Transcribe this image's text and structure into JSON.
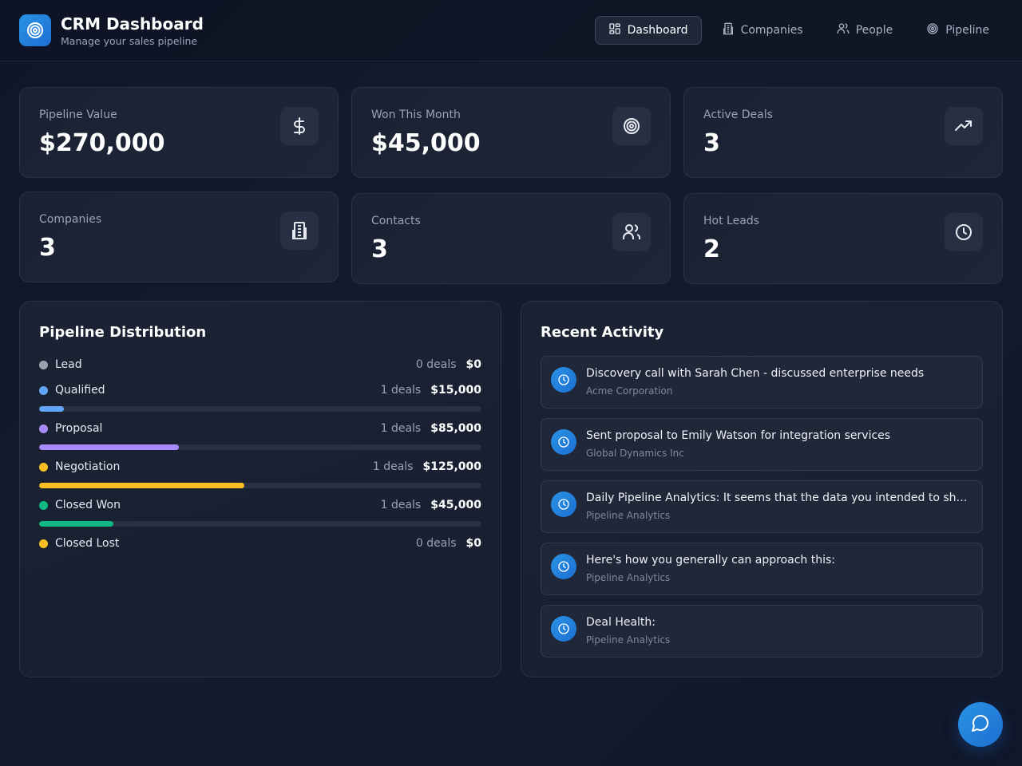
{
  "app": {
    "title": "CRM Dashboard",
    "subtitle": "Manage your sales pipeline",
    "logo_icon": "target-icon",
    "accent_color": "#2a93e6"
  },
  "nav": {
    "tabs": [
      {
        "label": "Dashboard",
        "icon": "dashboard-grid-icon",
        "active": true
      },
      {
        "label": "Companies",
        "icon": "building-icon",
        "active": false
      },
      {
        "label": "People",
        "icon": "users-icon",
        "active": false
      },
      {
        "label": "Pipeline",
        "icon": "target-icon",
        "active": false
      }
    ]
  },
  "stats": [
    {
      "label": "Pipeline Value",
      "value": "$270,000",
      "icon": "dollar-icon"
    },
    {
      "label": "Won This Month",
      "value": "$45,000",
      "icon": "target-icon"
    },
    {
      "label": "Active Deals",
      "value": "3",
      "icon": "trending-up-icon"
    },
    {
      "label": "Companies",
      "value": "3",
      "icon": "building-icon"
    },
    {
      "label": "Contacts",
      "value": "3",
      "icon": "users-icon"
    },
    {
      "label": "Hot Leads",
      "value": "2",
      "icon": "clock-icon"
    }
  ],
  "pipeline": {
    "title": "Pipeline Distribution",
    "stages": [
      {
        "name": "Lead",
        "count": "0 deals",
        "value": "$0",
        "color": "#9ca3af",
        "fraction": 0
      },
      {
        "name": "Qualified",
        "count": "1 deals",
        "value": "$15,000",
        "color": "#60a5fa",
        "fraction": 0.056
      },
      {
        "name": "Proposal",
        "count": "1 deals",
        "value": "$85,000",
        "color": "#a78bfa",
        "fraction": 0.315
      },
      {
        "name": "Negotiation",
        "count": "1 deals",
        "value": "$125,000",
        "color": "#fbbf24",
        "fraction": 0.463
      },
      {
        "name": "Closed Won",
        "count": "1 deals",
        "value": "$45,000",
        "color": "#10b981",
        "fraction": 0.167
      },
      {
        "name": "Closed Lost",
        "count": "0 deals",
        "value": "$0",
        "color": "#fbbf24",
        "fraction": 0
      }
    ]
  },
  "activity": {
    "title": "Recent Activity",
    "items": [
      {
        "title": "Discovery call with Sarah Chen - discussed enterprise needs",
        "subtitle": "Acme Corporation",
        "icon": "clock-icon"
      },
      {
        "title": "Sent proposal to Emily Watson for integration services",
        "subtitle": "Global Dynamics Inc",
        "icon": "clock-icon"
      },
      {
        "title": "Daily Pipeline Analytics: It seems that the data you intended to share for analysis is missing",
        "subtitle": "Pipeline Analytics",
        "icon": "clock-icon"
      },
      {
        "title": "Here's how you generally can approach this:",
        "subtitle": "Pipeline Analytics",
        "icon": "clock-icon"
      },
      {
        "title": "Deal Health:",
        "subtitle": "Pipeline Analytics",
        "icon": "clock-icon"
      }
    ]
  },
  "chat": {
    "icon": "chat-bubble-icon"
  }
}
